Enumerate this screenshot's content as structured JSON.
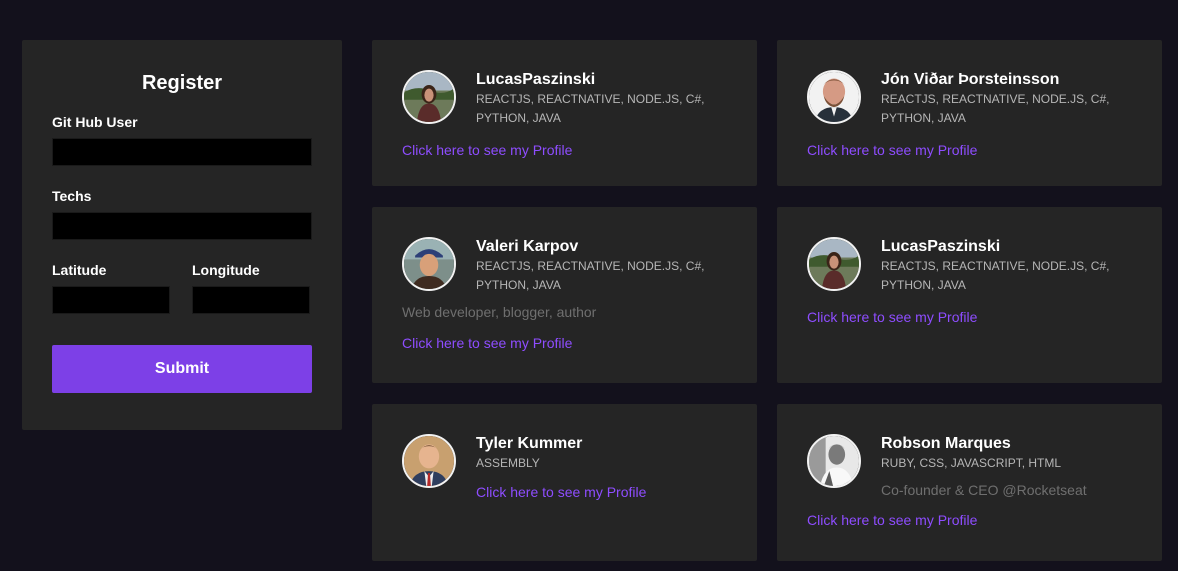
{
  "register": {
    "title": "Register",
    "github_label": "Git Hub User",
    "techs_label": "Techs",
    "latitude_label": "Latitude",
    "longitude_label": "Longitude",
    "submit_label": "Submit"
  },
  "devs": [
    {
      "name": "LucasPaszinski",
      "techs": "REACTJS, REACTNATIVE, NODE.JS, C#, PYTHON, JAVA",
      "bio": "",
      "link": "Click here to see my Profile"
    },
    {
      "name": "Jón Viðar Þorsteinsson",
      "techs": "REACTJS, REACTNATIVE, NODE.JS, C#, PYTHON, JAVA",
      "bio": "",
      "link": "Click here to see my Profile"
    },
    {
      "name": "Valeri Karpov",
      "techs": "REACTJS, REACTNATIVE, NODE.JS, C#, PYTHON, JAVA",
      "bio": "Web developer, blogger, author",
      "link": "Click here to see my Profile"
    },
    {
      "name": "LucasPaszinski",
      "techs": "REACTJS, REACTNATIVE, NODE.JS, C#, PYTHON, JAVA",
      "bio": "",
      "link": "Click here to see my Profile"
    },
    {
      "name": "Tyler Kummer",
      "techs": "ASSEMBLY",
      "bio": "",
      "link": "Click here to see my Profile"
    },
    {
      "name": "Robson Marques",
      "techs": "RUBY, CSS, JAVASCRIPT, HTML",
      "bio": "Co-founder & CEO @Rocketseat",
      "link": "Click here to see my Profile"
    }
  ],
  "colors": {
    "background": "#13111c",
    "panel": "#252525",
    "accent": "#7d40e7",
    "link": "#8e4dff"
  }
}
